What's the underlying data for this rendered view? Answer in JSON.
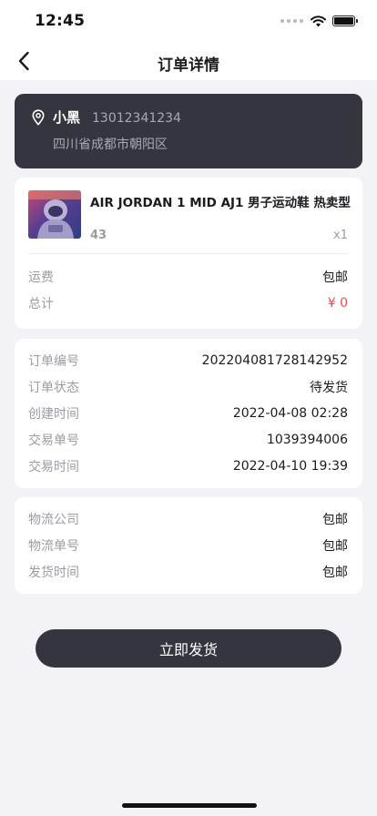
{
  "status_bar": {
    "time": "12:45"
  },
  "nav": {
    "title": "订单详情"
  },
  "address": {
    "name": "小黑",
    "phone": "13012341234",
    "detail": "四川省成都市朝阳区"
  },
  "product": {
    "title": "AIR JORDAN 1 MID AJ1 男子运动鞋 热卖型",
    "size": "43",
    "quantity": "x1",
    "shipping_label": "运费",
    "shipping_value": "包邮",
    "total_label": "总计",
    "total_value": "¥ 0"
  },
  "order": {
    "rows": [
      {
        "label": "订单编号",
        "value": "20220408172814295​2"
      },
      {
        "label": "订单状态",
        "value": "待发货"
      },
      {
        "label": "创建时间",
        "value": "2022-04-08 02:28"
      },
      {
        "label": "交易单号",
        "value": "1039394006"
      },
      {
        "label": "交易时间",
        "value": "2022-04-10 19:39"
      }
    ]
  },
  "logistics": {
    "rows": [
      {
        "label": "物流公司",
        "value": "包邮"
      },
      {
        "label": "物流单号",
        "value": "包邮"
      },
      {
        "label": "发货时间",
        "value": "包邮"
      }
    ]
  },
  "actions": {
    "ship_label": "立即发货"
  },
  "colors": {
    "accent_dark": "#34353f",
    "price_red": "#f04a42",
    "background": "#f3f2f7"
  }
}
